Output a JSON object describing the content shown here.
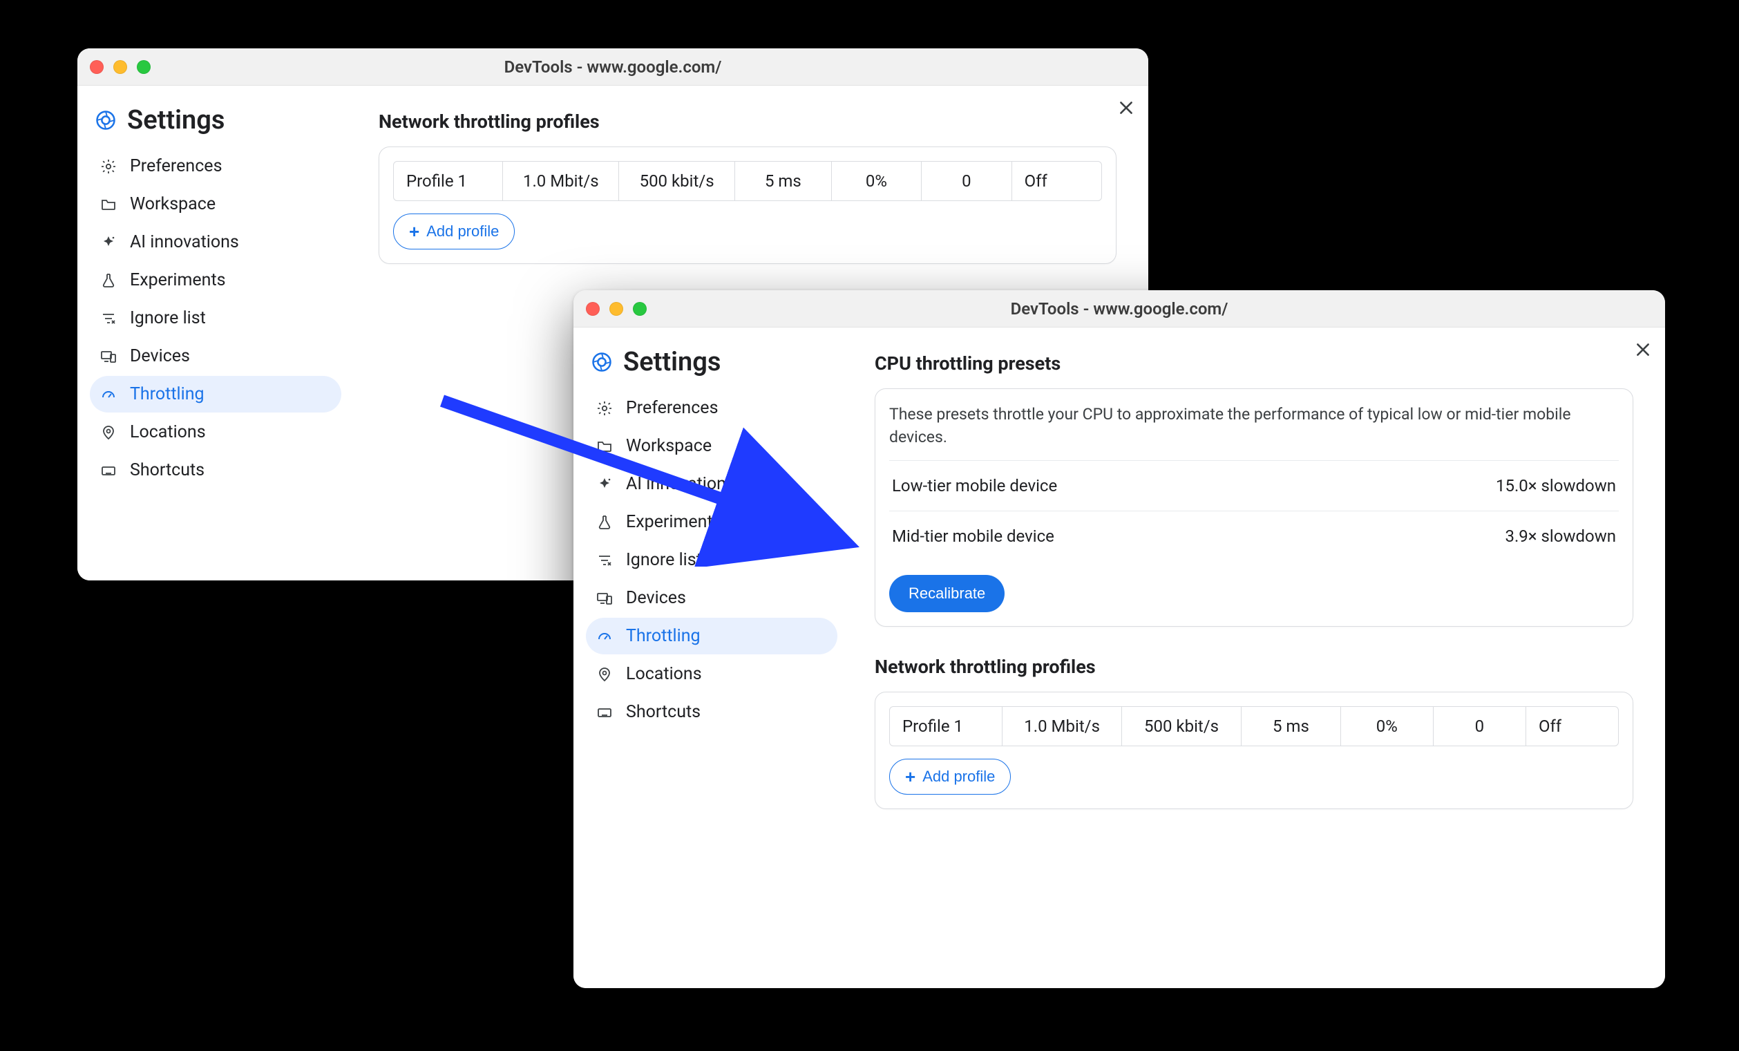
{
  "window1": {
    "title": "DevTools - www.google.com/",
    "settings_title": "Settings",
    "nav": [
      {
        "label": "Preferences",
        "icon": "gear-icon"
      },
      {
        "label": "Workspace",
        "icon": "folder-icon"
      },
      {
        "label": "AI innovations",
        "icon": "sparkle-diamond-icon"
      },
      {
        "label": "Experiments",
        "icon": "flask-icon"
      },
      {
        "label": "Ignore list",
        "icon": "filter-x-icon"
      },
      {
        "label": "Devices",
        "icon": "devices-icon"
      },
      {
        "label": "Throttling",
        "icon": "gauge-icon",
        "active": true
      },
      {
        "label": "Locations",
        "icon": "location-pin-icon"
      },
      {
        "label": "Shortcuts",
        "icon": "keyboard-icon"
      }
    ],
    "section_net_title": "Network throttling profiles",
    "profile": {
      "name": "Profile 1",
      "down": "1.0 Mbit/s",
      "up": "500 kbit/s",
      "latency": "5 ms",
      "loss": "0%",
      "queue": "0",
      "status": "Off"
    },
    "add_profile_label": "Add profile"
  },
  "window2": {
    "title": "DevTools - www.google.com/",
    "settings_title": "Settings",
    "nav": [
      {
        "label": "Preferences",
        "icon": "gear-icon"
      },
      {
        "label": "Workspace",
        "icon": "folder-icon"
      },
      {
        "label": "AI innovations",
        "icon": "sparkle-diamond-icon"
      },
      {
        "label": "Experiments",
        "icon": "flask-icon"
      },
      {
        "label": "Ignore list",
        "icon": "filter-x-icon"
      },
      {
        "label": "Devices",
        "icon": "devices-icon"
      },
      {
        "label": "Throttling",
        "icon": "gauge-icon",
        "active": true
      },
      {
        "label": "Locations",
        "icon": "location-pin-icon"
      },
      {
        "label": "Shortcuts",
        "icon": "keyboard-icon"
      }
    ],
    "cpu_title": "CPU throttling presets",
    "cpu_desc": "These presets throttle your CPU to approximate the performance of typical low or mid-tier mobile devices.",
    "cpu_presets": [
      {
        "name": "Low-tier mobile device",
        "value": "15.0× slowdown"
      },
      {
        "name": "Mid-tier mobile device",
        "value": "3.9× slowdown"
      }
    ],
    "recalibrate_label": "Recalibrate",
    "section_net_title": "Network throttling profiles",
    "profile": {
      "name": "Profile 1",
      "down": "1.0 Mbit/s",
      "up": "500 kbit/s",
      "latency": "5 ms",
      "loss": "0%",
      "queue": "0",
      "status": "Off"
    },
    "add_profile_label": "Add profile"
  },
  "colors": {
    "accent": "#1a73e8",
    "arrow": "#1f3bff"
  }
}
